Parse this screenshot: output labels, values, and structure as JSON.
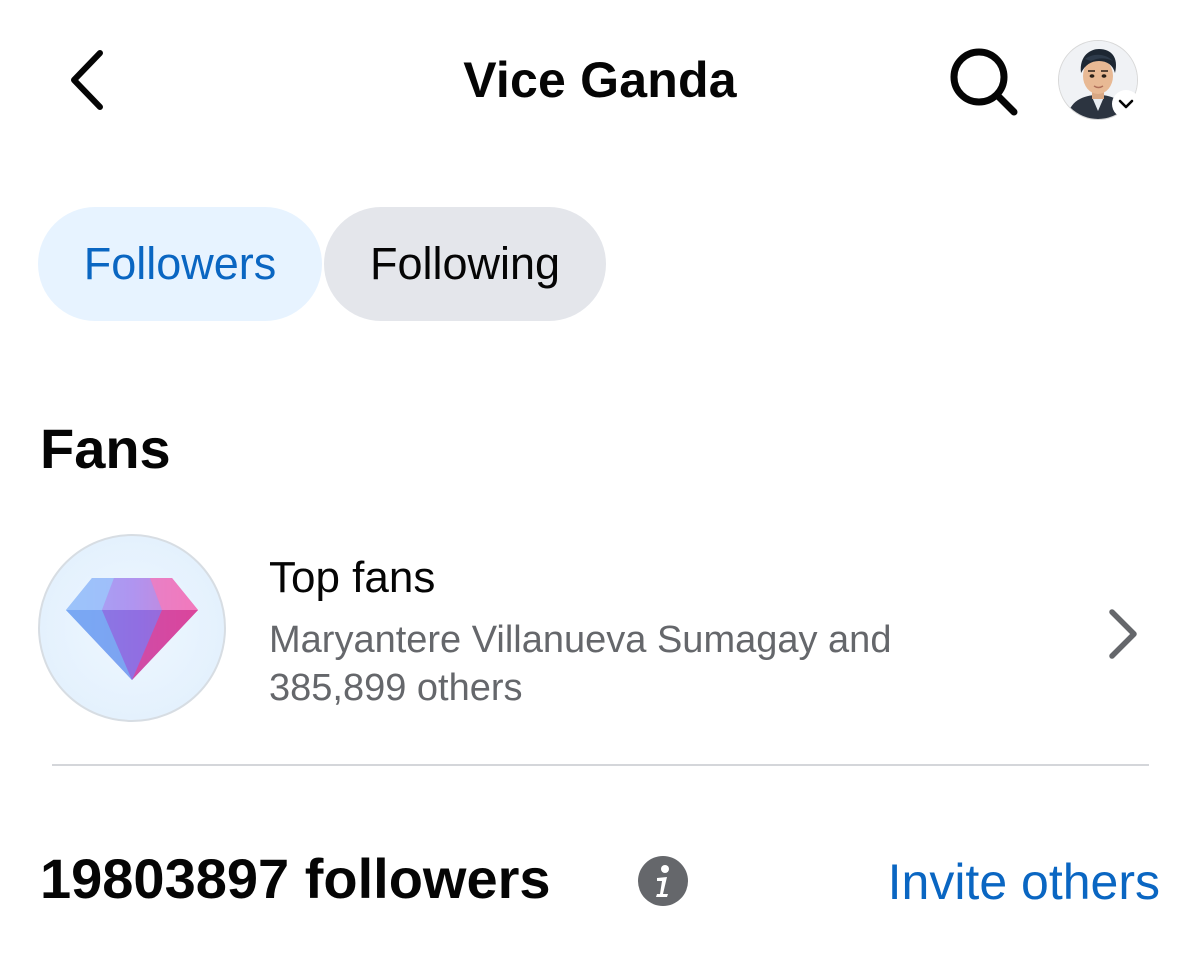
{
  "header": {
    "title": "Vice Ganda",
    "back_icon": "chevron-left-icon",
    "search_icon": "search-icon",
    "profile_menu_icon": "chevron-down-icon"
  },
  "tabs": [
    {
      "label": "Followers",
      "selected": true
    },
    {
      "label": "Following",
      "selected": false
    }
  ],
  "fans": {
    "heading": "Fans",
    "top_fans": {
      "title": "Top fans",
      "description": "Maryantere Villanueva Sumagay and 385,899 others",
      "icon": "diamond-icon"
    }
  },
  "followers": {
    "count_label": "19803897 followers",
    "info_icon": "info-icon",
    "invite_label": "Invite others"
  },
  "colors": {
    "accent": "#0a66c2",
    "selected_tab_bg": "#e7f3ff",
    "tab_bg": "#e4e6eb",
    "secondary_text": "#65676b"
  }
}
